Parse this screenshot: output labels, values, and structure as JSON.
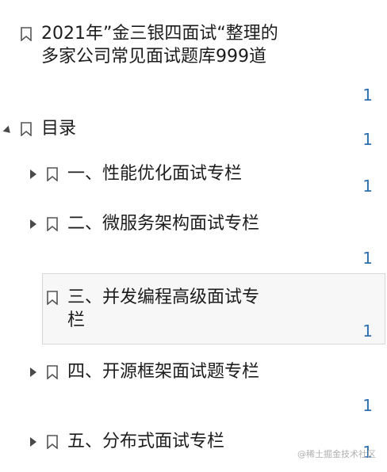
{
  "outline": [
    {
      "title": "2021年”金三银四面试“整理的多家公司常见面试题库999道",
      "page": "1"
    },
    {
      "title": "目录",
      "page": "1"
    },
    {
      "title": "一、性能优化面试专栏",
      "page": "1"
    },
    {
      "title": "二、微服务架构面试专栏",
      "page": "1"
    },
    {
      "title": "三、并发编程高级面试专栏",
      "page": "1"
    },
    {
      "title": "四、开源框架面试题专栏",
      "page": "1"
    },
    {
      "title": "五、分布式面试专栏",
      "page": "1"
    }
  ],
  "watermark": "@稀土掘金技术社区",
  "icons": {
    "bookmark": "bookmark-icon",
    "expand": "chevron-right-icon",
    "collapse": "chevron-down-icon"
  },
  "colors": {
    "page_number": "#2f6fb0",
    "selected_bg": "#f7f7f7"
  }
}
